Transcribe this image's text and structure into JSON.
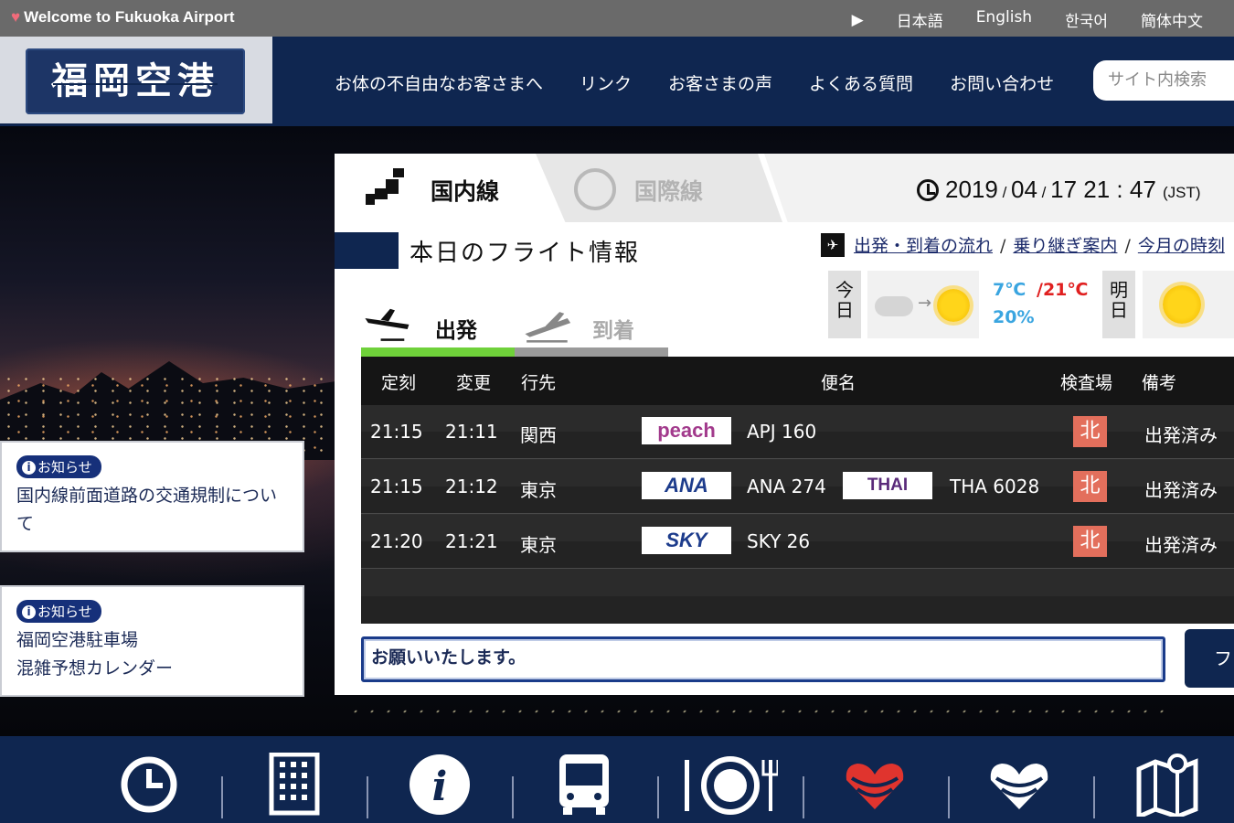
{
  "topbar": {
    "welcome": "Welcome to Fukuoka Airport",
    "languages": [
      "日本語",
      "English",
      "한국어",
      "簡体中文"
    ]
  },
  "header": {
    "logo_text": "福岡空港",
    "nav": [
      "お体の不自由なお客さまへ",
      "リンク",
      "お客さまの声",
      "よくある質問",
      "お問い合わせ"
    ],
    "search_placeholder": "サイト内検索"
  },
  "notices": [
    {
      "badge": "お知らせ",
      "text": "国内線前面道路の交通規制について"
    },
    {
      "badge": "お知らせ",
      "text_line1": "福岡空港駐車場",
      "text_line2": "混雑予想カレンダー"
    }
  ],
  "flight_panel": {
    "tabs": [
      "国内線",
      "国際線"
    ],
    "datetime": {
      "year": "2019",
      "month": "04",
      "day": "17",
      "hour": "21",
      "minute": "47",
      "tz": "(JST)"
    },
    "title": "本日のフライト情報",
    "links": [
      "出発・到着の流れ",
      "乗り継ぎ案内",
      "今月の時刻"
    ],
    "dep_arr": [
      "出発",
      "到着"
    ],
    "weather": {
      "today_label": "今日",
      "tomorrow_label": "明日",
      "low": "7℃",
      "high": "/21℃",
      "rain": "20%"
    },
    "columns": [
      "定刻",
      "変更",
      "行先",
      "便名",
      "検査場",
      "備考"
    ],
    "flights": [
      {
        "scheduled": "21:15",
        "changed": "21:11",
        "dest": "関西",
        "logo1": "peach",
        "flight1": "APJ 160",
        "logo2": "",
        "flight2": "",
        "gate": "北",
        "status": "出発済み"
      },
      {
        "scheduled": "21:15",
        "changed": "21:12",
        "dest": "東京",
        "logo1": "ANA",
        "flight1": "ANA 274",
        "logo2": "THAI",
        "flight2": "THA 6028",
        "gate": "北",
        "status": "出発済み"
      },
      {
        "scheduled": "21:20",
        "changed": "21:21",
        "dest": "東京",
        "logo1": "SKY",
        "flight1": "SKY 26",
        "logo2": "",
        "flight2": "",
        "gate": "北",
        "status": "出発済み"
      }
    ],
    "ime_text": "お願いいたします。",
    "more_button": "フ"
  },
  "footer_icons": [
    "clock-icon",
    "building-icon",
    "info-icon",
    "bus-icon",
    "dining-icon",
    "heart-logo-icon",
    "heart-outline-icon",
    "map-icon"
  ],
  "colors": {
    "navy": "#0f2650",
    "accent_green": "#6fd13a",
    "gate_red": "#e36f5c",
    "topbar": "#6a6a6a"
  }
}
